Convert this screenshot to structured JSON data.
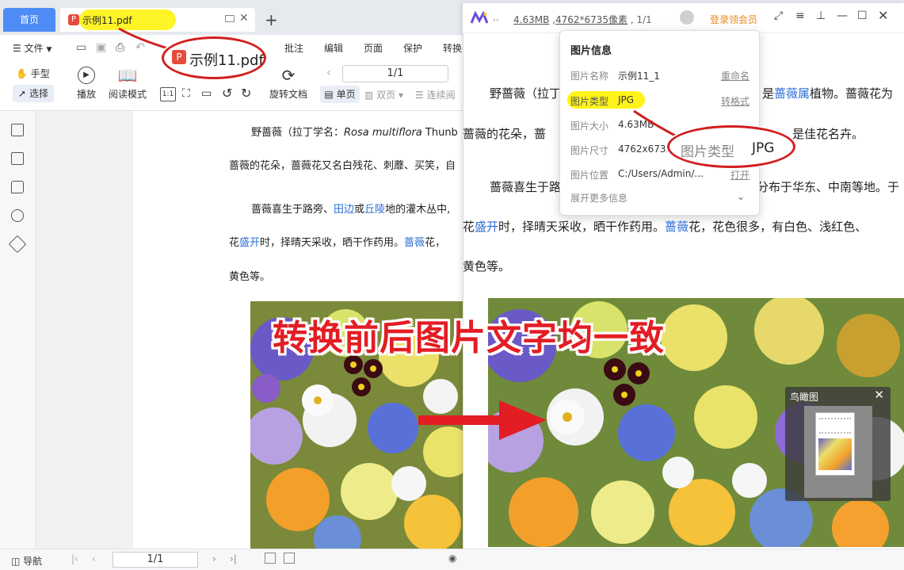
{
  "tabs": {
    "home": "首页",
    "file": "示例11.pdf"
  },
  "menu": {
    "file": "文件",
    "annotate": "批注",
    "edit": "编辑",
    "page": "页面",
    "protect": "保护",
    "convert": "转换"
  },
  "toolbar": {
    "hand": "手型",
    "select": "选择",
    "play": "播放",
    "reading_mode": "阅读模式",
    "rotate_doc": "旋转文档",
    "single_page": "单页",
    "double_page": "双页",
    "continuous": "连续阅",
    "page_value": "1/1"
  },
  "doc_left": {
    "line1_a": "野蔷薇（拉丁学名：",
    "line1_b": "Rosa multiflora",
    "line1_c": " Thunb",
    "line2": "蔷薇的花朵，蔷薇花又名白残花、刺蘼、买笑，自",
    "line3_a": "蔷薇喜生于路旁、",
    "line3_b": "田边",
    "line3_c": "或",
    "line3_d": "丘陵",
    "line3_e": "地的灌木丛中,",
    "line4_a": "花",
    "line4_b": "盛开",
    "line4_c": "时，择晴天采收，晒干作药用。",
    "line4_d": "蔷薇",
    "line4_e": "花，",
    "line5": "黄色等。"
  },
  "viewer": {
    "filesize": "4.63MB",
    "dimensions": "4762*6735像素",
    "page": "1/1",
    "vip": "登录领会员"
  },
  "doc_right": {
    "line1_a": "野蔷薇（拉丁",
    "line1_b": "是",
    "line1_c": "蔷薇属",
    "line1_d": "植物。蔷薇花为",
    "line2_a": "蔷薇的花朵，蔷",
    "line2_b": "是佳花名卉。",
    "line3_a": "蔷薇喜生于路",
    "line3_b": "分布于华东、中南等地。于",
    "line4_a": "花",
    "line4_b": "盛开",
    "line4_c": "时，择晴天采收，晒干作药用。",
    "line4_d": "蔷薇",
    "line4_e": "花，花色很多，有白色、浅红色、",
    "line5": "黄色等。"
  },
  "info_popup": {
    "title": "图片信息",
    "rows": [
      {
        "key": "图片名称",
        "value": "示例11_1",
        "action": "重命名"
      },
      {
        "key": "图片类型",
        "value": "JPG",
        "action": "转格式"
      },
      {
        "key": "图片大小",
        "value": "4.63MB",
        "action": ""
      },
      {
        "key": "图片尺寸",
        "value": "4762x6735",
        "action": ""
      },
      {
        "key": "图片位置",
        "value": "C:/Users/Admin/...",
        "action": "打开"
      }
    ],
    "more": "展开更多信息"
  },
  "callouts": {
    "file": "示例11.pdf",
    "type_key": "图片类型",
    "type_value": "JPG",
    "headline": "转换前后图片文字均一致"
  },
  "thumbnail": {
    "title": "鸟瞰图"
  },
  "status": {
    "nav": "导航",
    "page": "1/1"
  },
  "colors": {
    "accent": "#4d8cf5",
    "link": "#2c6fd6",
    "callout_red": "#d21f1f",
    "highlight": "#fff200",
    "vip": "#e98a1b"
  }
}
